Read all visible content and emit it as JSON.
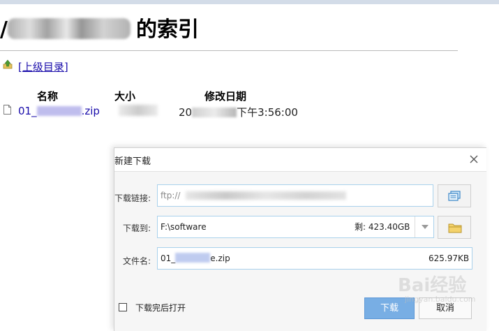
{
  "page": {
    "title_prefix": "/",
    "title_suffix": "的索引",
    "parent_link": "[上级目录]",
    "headers": {
      "name": "名称",
      "size": "大小",
      "modified": "修改日期"
    },
    "file": {
      "name_start": "01_",
      "name_end": ".zip",
      "date_start": "20",
      "date_end": "下午3:56:00"
    }
  },
  "dialog": {
    "title": "新建下载",
    "link_label": "下载链接:",
    "link_value_start": "ftp://",
    "saveto_label": "下载到:",
    "saveto_value": "F:\\software",
    "free_space": "剩: 423.40GB",
    "filename_label": "文件名:",
    "filename_start": "01_",
    "filename_end": "e.zip",
    "file_size": "625.97KB",
    "open_after_label": "下载完后打开",
    "download_button": "下载",
    "cancel_button": "取消"
  },
  "watermark": {
    "text": "Bai经验",
    "sub": "jingyan.baidu.com"
  },
  "colors": {
    "link": "#1a0dab",
    "accent": "#78aee4",
    "field_border": "#a9d1ec"
  }
}
